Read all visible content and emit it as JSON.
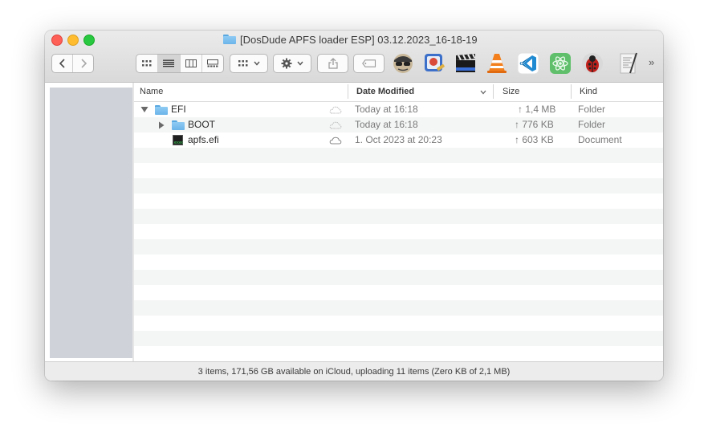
{
  "window": {
    "title": "[DosDude APFS loader ESP] 03.12.2023_16-18-19"
  },
  "toolbar": {
    "back_icon": "chevron-left-icon",
    "forward_icon": "chevron-right-icon",
    "view_modes": [
      "icon-view-icon",
      "list-view-icon",
      "column-view-icon",
      "gallery-view-icon"
    ],
    "active_view": "list",
    "group_icon": "group-by-icon",
    "action_icon": "gear-icon",
    "share_icon": "share-icon",
    "tag_icon": "tag-icon",
    "apps": [
      "spy-app-icon",
      "scanner-app-icon",
      "clapperboard-app-icon",
      "vlc-app-icon",
      "vscode-app-icon",
      "atom-app-icon",
      "ladybug-app-icon",
      "script-editor-app-icon"
    ],
    "overflow_label": "»"
  },
  "columns": {
    "name": "Name",
    "date_modified": "Date Modified",
    "size": "Size",
    "kind": "Kind"
  },
  "rows": [
    {
      "name": "EFI",
      "date": "Today at 16:18",
      "size": "↑ 1,4 MB",
      "kind": "Folder",
      "indent": 0,
      "disclosure": "expanded",
      "icon": "folder-icon"
    },
    {
      "name": "BOOT",
      "date": "Today at 16:18",
      "size": "↑ 776 KB",
      "kind": "Folder",
      "indent": 1,
      "disclosure": "collapsed",
      "icon": "folder-icon"
    },
    {
      "name": "apfs.efi",
      "date": "1. Oct 2023 at 20:23",
      "size": "↑ 603 KB",
      "kind": "Document",
      "indent": 1,
      "disclosure": "none",
      "icon": "exec-file-icon"
    }
  ],
  "status": {
    "text": "3 items, 171,56 GB available on iCloud, uploading 11 items (Zero KB of 2,1 MB)"
  },
  "colors": {
    "close": "#fe5f57",
    "minimize": "#febc2e",
    "maximize": "#28c840",
    "folder": "#6bb4ea",
    "sidebar": "#cfd2d8"
  }
}
